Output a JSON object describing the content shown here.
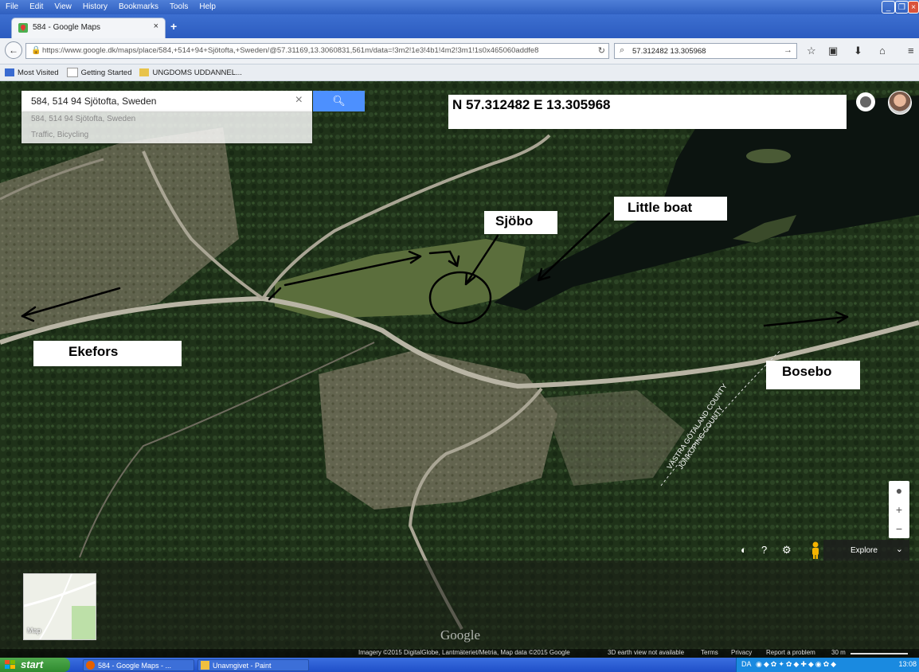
{
  "browser": {
    "menu": [
      "File",
      "Edit",
      "View",
      "History",
      "Bookmarks",
      "Tools",
      "Help"
    ],
    "tab_title": "584 - Google Maps",
    "tab_close": "×",
    "new_tab": "+",
    "url": "https://www.google.dk/maps/place/584,+514+94+Sjötofta,+Sweden/@57.31169,13.3060831,561m/data=!3m2!1e3!4b1!4m2!3m1!1s0x465060addfe8",
    "search_value": "57.312482 13.305968",
    "bookmarks": [
      "Most Visited",
      "Getting Started",
      "UNGDOMS UDDANNEL..."
    ]
  },
  "maps": {
    "search_value": "584, 514 94 Sjötofta, Sweden",
    "suggestions": [
      "584, 514 94 Sjötofta, Sweden",
      "Traffic, Bicycling"
    ],
    "explore_label": "Explore",
    "thumbnail_label": "Map",
    "watermark": "Google",
    "footer": {
      "imagery": "Imagery ©2015 DigitalGlobe, Lantmäteriet/Metria, Map data ©2015 Google",
      "earth": "3D earth view not available",
      "terms": "Terms",
      "privacy": "Privacy",
      "report": "Report a problem",
      "scale": "30 m"
    },
    "county_label_1": "VÄSTRA GÖTALAND COUNTY",
    "county_label_2": "JÖNKÖPING COUNTY"
  },
  "annotations": {
    "coordinates": "N 57.312482  E 13.305968",
    "sjobo": "Sjöbo",
    "little_boat": "Little boat",
    "ekefors": "Ekefors",
    "bosebo": "Bosebo"
  },
  "taskbar": {
    "start": "start",
    "tasks": [
      "584 - Google Maps - ...",
      "Unavngivet - Paint"
    ],
    "tray_lang": "DA",
    "clock": "13:08"
  },
  "colors": {
    "search_button": "#4d90fe",
    "forest": "#1f3219",
    "lake": "#0c1410",
    "road": "#b8b4a4"
  }
}
